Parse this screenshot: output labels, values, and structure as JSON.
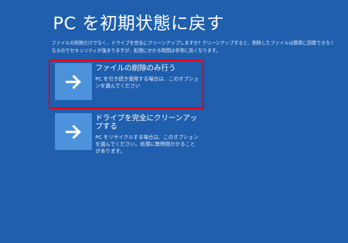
{
  "page": {
    "title": "PC を初期状態に戻す",
    "description": "ファイルの削除だけでなく、ドライブを完全にクリーンアップしますか? クリーンアップすると、削除したファイルは簡単に回復できなくなるのでセキュリティが強まりますが、処理にかかる時間は非常に長くなります。"
  },
  "options": [
    {
      "title": "ファイルの削除のみ行う",
      "description": "PC を引き続き使用する場合は、このオプションを選んでください",
      "icon": "arrow-right-icon"
    },
    {
      "title": "ドライブを完全にクリーンアップする",
      "description": "PC をリサイクルする場合は、このオプションを選んでください。処理に数時間かかることがあります。",
      "icon": "arrow-right-icon"
    }
  ],
  "colors": {
    "background": "#1f5fae",
    "tile": "#4d93dc",
    "highlight": "#e50012",
    "text": "#ffffff"
  }
}
